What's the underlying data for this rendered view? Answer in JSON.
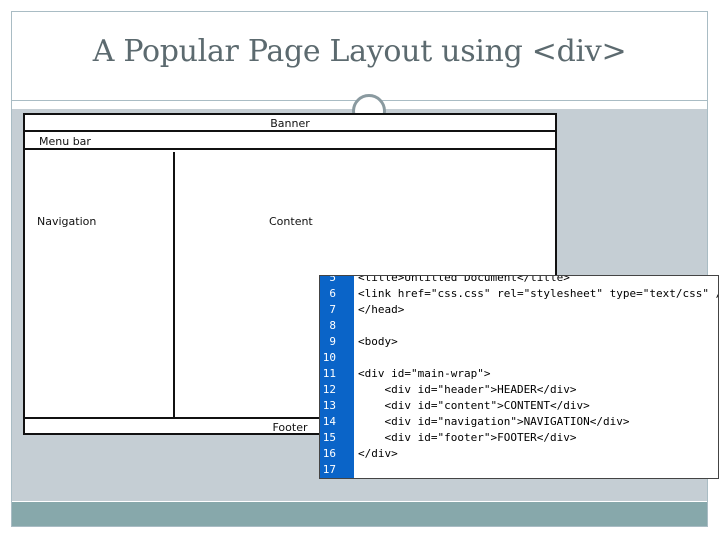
{
  "slide": {
    "title": "A Popular Page Layout using <div>"
  },
  "diagram": {
    "banner": "Banner",
    "menu_bar": "Menu bar",
    "navigation": "Navigation",
    "content": "Content",
    "footer": "Footer"
  },
  "code": {
    "lines": [
      {
        "num": "5",
        "text": "<title>Untitled Document</title>"
      },
      {
        "num": "6",
        "text": "<link href=\"css.css\" rel=\"stylesheet\" type=\"text/css\" />"
      },
      {
        "num": "7",
        "text": "</head>"
      },
      {
        "num": "8",
        "text": ""
      },
      {
        "num": "9",
        "text": "<body>"
      },
      {
        "num": "10",
        "text": ""
      },
      {
        "num": "11",
        "text": "<div id=\"main-wrap\">"
      },
      {
        "num": "12",
        "text": "    <div id=\"header\">HEADER</div>"
      },
      {
        "num": "13",
        "text": "    <div id=\"content\">CONTENT</div>"
      },
      {
        "num": "14",
        "text": "    <div id=\"navigation\">NAVIGATION</div>"
      },
      {
        "num": "15",
        "text": "    <div id=\"footer\">FOOTER</div>"
      },
      {
        "num": "16",
        "text": "</div>"
      },
      {
        "num": "17",
        "text": ""
      }
    ]
  },
  "colors": {
    "gutter": "#0a64c8",
    "content_bg": "#c5ced4",
    "bottom_bar": "#87a8ab"
  }
}
